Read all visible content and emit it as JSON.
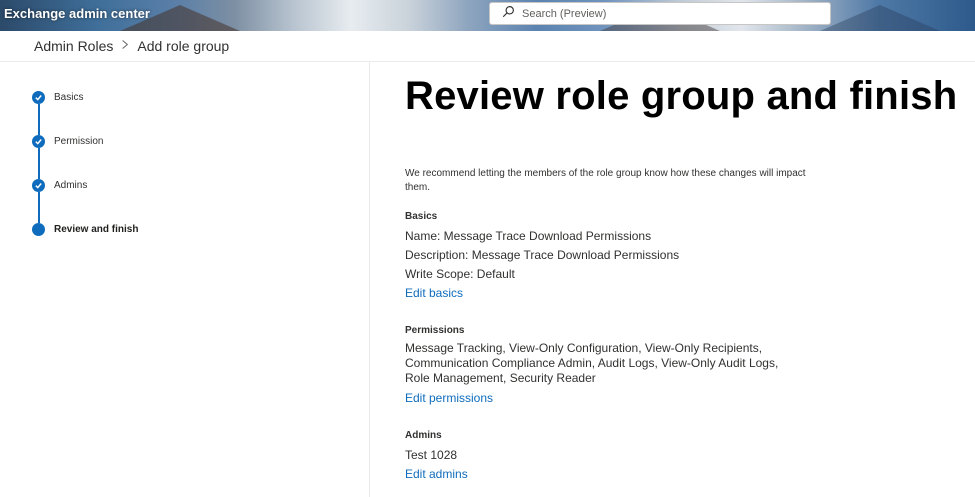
{
  "header": {
    "app_title": "Exchange admin center",
    "search_placeholder": "Search (Preview)"
  },
  "breadcrumb": {
    "parent": "Admin Roles",
    "separator": ">",
    "current": "Add role group"
  },
  "steps": [
    {
      "label": "Basics",
      "state": "complete"
    },
    {
      "label": "Permission",
      "state": "complete"
    },
    {
      "label": "Admins",
      "state": "complete"
    },
    {
      "label": "Review and finish",
      "state": "current"
    }
  ],
  "main": {
    "title": "Review role group and finish",
    "intro": "We recommend letting the members of the role group know how these changes will impact them.",
    "basics": {
      "heading": "Basics",
      "name": "Name: Message Trace Download Permissions",
      "description": "Description: Message Trace Download Permissions",
      "write_scope": "Write Scope: Default",
      "edit_label": "Edit basics"
    },
    "permissions": {
      "heading": "Permissions",
      "value": "Message Tracking, View-Only Configuration, View-Only Recipients, Communication Compliance Admin, Audit Logs, View-Only Audit Logs, Role Management, Security Reader",
      "edit_label": "Edit permissions"
    },
    "admins": {
      "heading": "Admins",
      "value": "Test 1028",
      "edit_label": "Edit admins"
    }
  },
  "colors": {
    "accent": "#0f6cbd",
    "text": "#323130"
  }
}
